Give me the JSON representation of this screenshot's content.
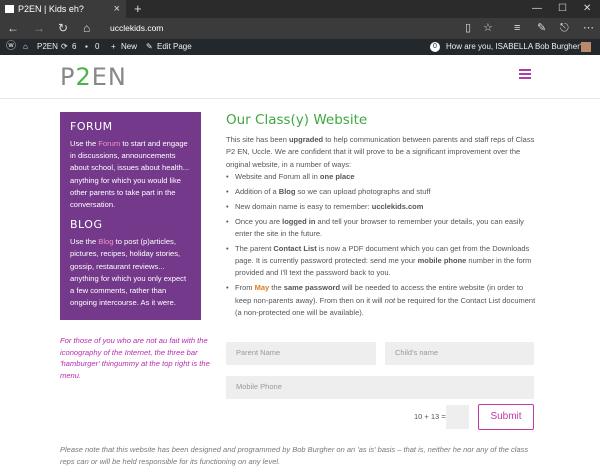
{
  "browser": {
    "tab_title": "P2EN | Kids eh?",
    "url": "ucclekids.com"
  },
  "adminbar": {
    "site_name": "P2EN",
    "updates_count": "6",
    "comments_count": "0",
    "new_label": "New",
    "edit_label": "Edit Page",
    "notif_count": "0",
    "greeting": "How are you, ISABELLA Bob Burgher?"
  },
  "header": {
    "logo_p": "P",
    "logo_2": "2",
    "logo_en": "EN"
  },
  "sidebar": {
    "forum_heading": "FORUM",
    "forum_pre": "Use the ",
    "forum_link": "Forum",
    "forum_post": " to start and engage in discussions, announcements about school, issues about health... anything for which you would like other parents to take part in the conversation.",
    "blog_heading": "BLOG",
    "blog_pre": "Use the ",
    "blog_link": "Blog",
    "blog_post": " to post (p)articles, pictures, recipes, holiday stories, gossip, restaurant reviews... anything for which you only expect a few comments, rather than ongoing intercourse. As it were."
  },
  "hamburger_note": "For those of you who are not au fait with the iconography of the Internet, the three bar 'hamburger' thingummy at the top right is the menu.",
  "main": {
    "title": "Our Class(y) Website",
    "intro_1": "This site has been ",
    "intro_2": "upgraded",
    "intro_3": " to help communication between parents and staff reps of Class P2 EN, Uccle. We are confident that it will prove to be a significant improvement over the original website, in a number of ways:",
    "b1_pre": "Website and Forum all in ",
    "b1_bold": "one place",
    "b2_pre": "Addition of a ",
    "b2_bold": "Blog",
    "b2_post": " so we can upload photographs and stuff",
    "b3_pre": "New domain name is easy to remember: ",
    "b3_bold": "ucclekids.com",
    "b4_pre": "Once you are ",
    "b4_bold": "logged in",
    "b4_post": " and tell your browser to remember your details, you can easily enter the site in the future.",
    "b5_pre": "The parent ",
    "b5_bold": "Contact List",
    "b5_mid": " is now a PDF document which you can get from the Downloads page. It is currently password protected: send me your ",
    "b5_bold2": "mobile phone",
    "b5_post": " number in the form provided and I'll text the password back to you.",
    "b6_pre": "From ",
    "b6_may": "May",
    "b6_mid": " the ",
    "b6_bold": "same password",
    "b6_post1": " will be needed to access the entire website (in order to keep non-parents away). From then on it will ",
    "b6_not": "not",
    "b6_post2": " be required for the Contact List document (a non-protected one will be available)."
  },
  "form": {
    "parent_name_placeholder": "Parent Name",
    "child_name_placeholder": "Child's name",
    "mobile_placeholder": "Mobile Phone",
    "captcha": "10 + 13 =",
    "submit_label": "Submit"
  },
  "footer_note": "Please note that this website has been designed and programmed by Bob Burgher on an 'as is' basis – that is, neither he nor any of the class reps can or will be held responsible for its functioning on any level."
}
